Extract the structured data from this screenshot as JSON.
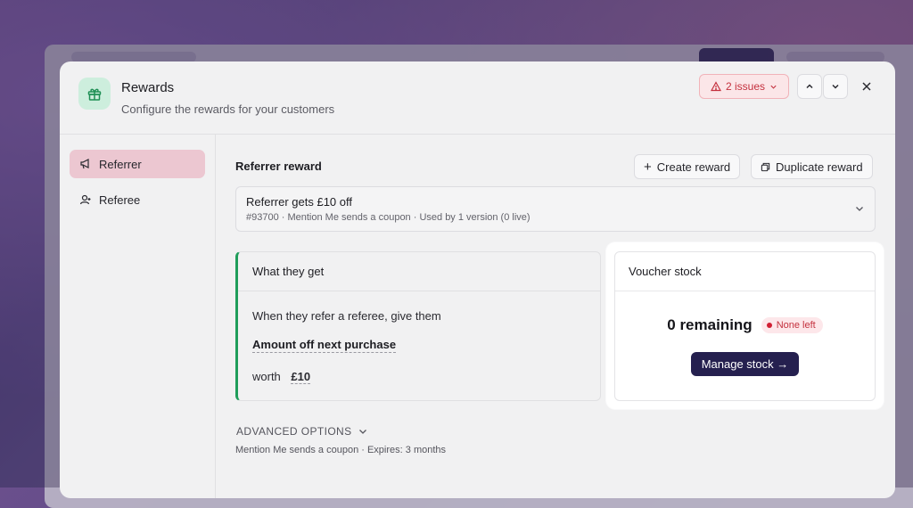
{
  "header": {
    "title": "Rewards",
    "subtitle": "Configure the rewards for your customers",
    "issues_label": "2 issues"
  },
  "sidebar": {
    "items": [
      {
        "label": "Referrer",
        "icon": "megaphone-icon",
        "active": true
      },
      {
        "label": "Referee",
        "icon": "user-add-icon",
        "active": false
      }
    ]
  },
  "main": {
    "section_title": "Referrer reward",
    "create_label": "Create reward",
    "duplicate_label": "Duplicate reward",
    "reward": {
      "name": "Referrer gets £10 off",
      "meta": "#93700 · Mention Me sends a coupon · Used by 1 version (0 live)"
    },
    "what_they_get": {
      "title": "What they get",
      "line1": "When they refer a referee, give them",
      "reward_type": "Amount off next purchase",
      "worth_label": "worth",
      "worth_value": "£10"
    },
    "voucher_stock": {
      "title": "Voucher stock",
      "remaining": "0 remaining",
      "badge": "None left",
      "manage_label": "Manage stock →"
    },
    "advanced": {
      "label": "ADVANCED OPTIONS",
      "meta": "Mention Me sends a coupon · Expires: 3 months"
    }
  },
  "colors": {
    "accent_dark": "#25204f",
    "active_nav": "#ecc7d1",
    "success_border": "#1f9d5a",
    "danger": "#c4313e"
  }
}
